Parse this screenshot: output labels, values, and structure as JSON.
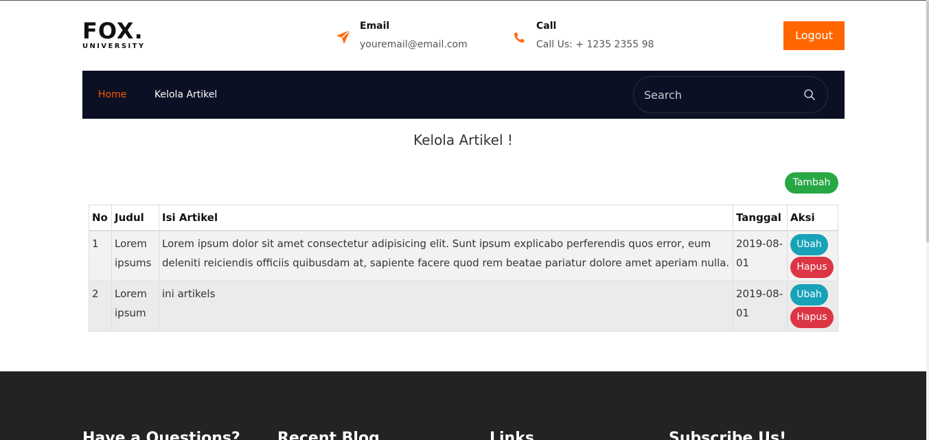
{
  "logo": {
    "main": "FOX.",
    "sub": "UNIVERSITY"
  },
  "contacts": [
    {
      "icon": "paper-plane-icon",
      "label": "Email",
      "value": "youremail@email.com"
    },
    {
      "icon": "phone-icon",
      "label": "Call",
      "value": "Call Us: + 1235 2355 98"
    }
  ],
  "logout_label": "Logout",
  "nav": {
    "home": "Home",
    "kelola": "Kelola Artikel"
  },
  "search": {
    "placeholder": "Search"
  },
  "page_title": "Kelola Artikel !",
  "add_button": "Tambah",
  "table": {
    "headers": [
      "No",
      "Judul",
      "Isi Artikel",
      "Tanggal",
      "Aksi"
    ],
    "rows": [
      {
        "no": "1",
        "judul": "Lorem ipsums",
        "isi": "Lorem ipsum dolor sit amet consectetur adipisicing elit. Sunt ipsum explicabo perferendis quos error, eum deleniti reiciendis officiis quibusdam at, sapiente facere quod rem beatae pariatur dolore amet aperiam nulla.",
        "tanggal": "2019-08-01",
        "edit": "Ubah",
        "delete": "Hapus"
      },
      {
        "no": "2",
        "judul": "Lorem ipsum",
        "isi": "ini artikels",
        "tanggal": "2019-08-01",
        "edit": "Ubah",
        "delete": "Hapus"
      }
    ]
  },
  "footer": {
    "headings": [
      "Have a Questions?",
      "Recent Blog",
      "Links",
      "Subscribe Us!"
    ]
  },
  "colors": {
    "accent": "#ff6600",
    "navbar": "#0c1024",
    "add": "#28a745",
    "edit": "#17a2b8",
    "delete": "#dc3545",
    "footer": "#232323"
  }
}
